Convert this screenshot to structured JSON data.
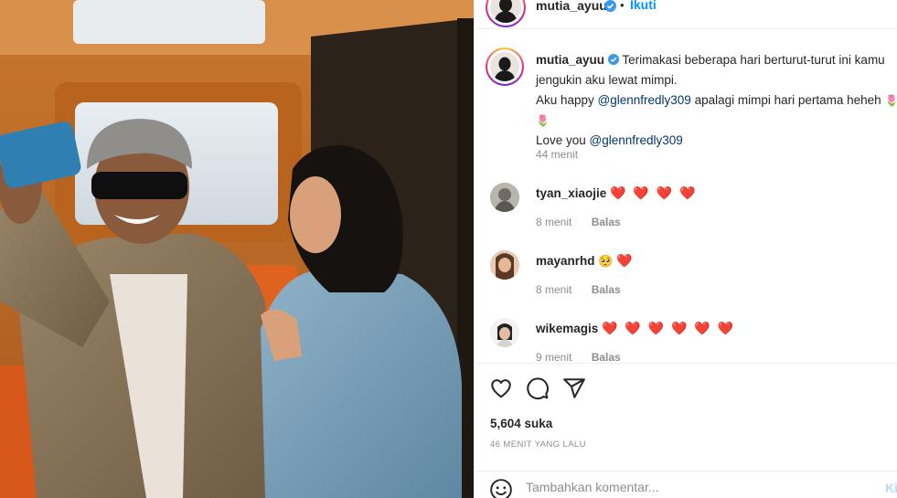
{
  "post": {
    "author": "mutia_ayuu",
    "follow_label": "Ikuti",
    "separator": "•"
  },
  "caption": {
    "username": "mutia_ayuu",
    "line1": "Terimakasi beberapa hari berturut-turut ini kamu",
    "line2": "jengukin aku lewat mimpi.",
    "line3_prefix": "Aku happy ",
    "line3_mention": "@glennfredly309",
    "line3_suffix": " apalagi mimpi hari pertama heheh",
    "line4_prefix": "Love you ",
    "line4_mention": "@glennfredly309",
    "time": "44 menit"
  },
  "comments": [
    {
      "username": "tyan_xiaojie",
      "text": "❤️ ❤️ ❤️ ❤️",
      "time": "8 menit",
      "reply": "Balas"
    },
    {
      "username": "mayanrhd",
      "emoji": "🥺",
      "text": "❤️",
      "time": "8 menit",
      "reply": "Balas"
    },
    {
      "username": "wikemagis",
      "text": "❤️ ❤️ ❤️ ❤️ ❤️ ❤️",
      "time": "9 menit",
      "reply": "Balas"
    }
  ],
  "likes": "5,604 suka",
  "timestamp": "46 MENIT YANG LALU",
  "comment_input": {
    "placeholder": "Tambahkan komentar...",
    "post_label": "Ki"
  },
  "icons": [
    "heart-icon",
    "comment-icon",
    "share-icon",
    "emoji-icon",
    "verified-badge-icon"
  ],
  "colors": {
    "link": "#0095f6",
    "mention": "#00376b",
    "heart": "#ed4956",
    "muted": "#8e8e8e"
  }
}
